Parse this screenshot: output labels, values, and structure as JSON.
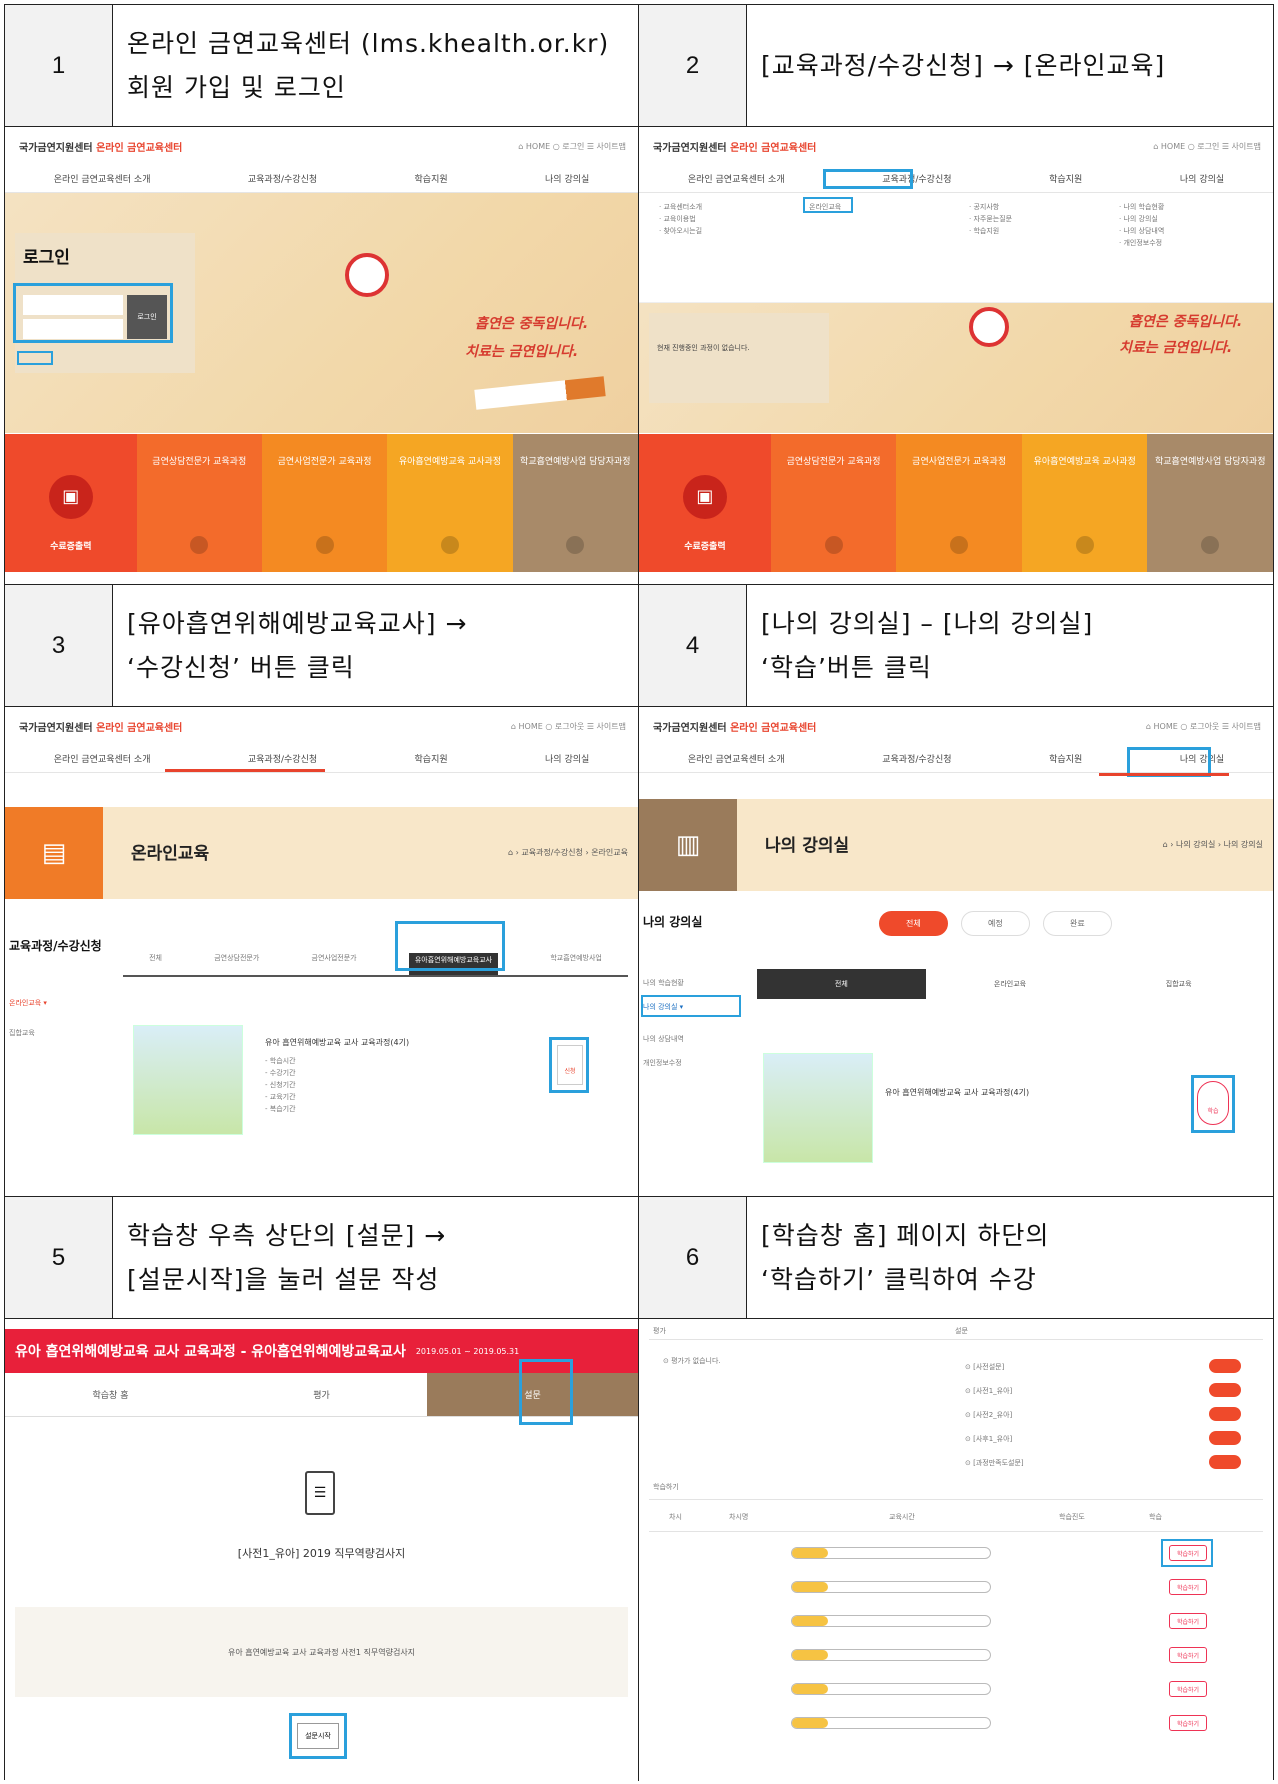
{
  "steps": [
    {
      "num": "1",
      "line1": "온라인 금연교육센터 (lms.khealth.or.kr)",
      "line2": "회원 가입 및 로그인"
    },
    {
      "num": "2",
      "line1": "[교육과정/수강신청] → [온라인교육]",
      "line2": ""
    },
    {
      "num": "3",
      "line1": "[유아흡연위해예방교육교사] →",
      "line2": "‘수강신청’ 버튼 클릭"
    },
    {
      "num": "4",
      "line1": "[나의 강의실] – [나의 강의실]",
      "line2": "‘학습’버튼 클릭"
    },
    {
      "num": "5",
      "line1": "학습창 우측 상단의 [설문] →",
      "line2": "[설문시작]을 눌러 설문 작성"
    },
    {
      "num": "6",
      "line1": "[학습창 홈] 페이지 하단의",
      "line2": "‘학습하기’ 클릭하여 수강"
    }
  ],
  "site": {
    "logo_prefix": "국가금연지원센터",
    "logo_name": "온라인 금연교육센터",
    "nav": [
      "온라인 금연교육센터 소개",
      "교육과정/수강신청",
      "학습지원",
      "나의 강의실"
    ],
    "login_title": "로그인",
    "login_button": "로그인",
    "slogan1": "흡연은 중독입니다.",
    "slogan2": "치료는 금연입니다.",
    "notice": "현재 진행중인 과정이 없습니다.",
    "cert_tile": "수료증출력",
    "tiles": [
      "금연상담전문가 교육과정",
      "금연사업전문가 교육과정",
      "유아흡연예방교육 교사과정",
      "학교흡연예방사업 담당자과정"
    ],
    "online_edu": "온라인교육",
    "my_room": "나의 강의실",
    "side_menu_title": "교육과정/수강신청",
    "course_name": "유아 흡연위해예방교육 교사 교육과정(4기)",
    "survey_header": "유아 흡연위해예방교육 교사 교육과정 - 유아흡연위해예방교육교사",
    "survey_dates": "2019.05.01 ~ 2019.05.31",
    "survey_tabs": [
      "학습창 홈",
      "평가",
      "설문"
    ],
    "survey_title": "[사전1_유아] 2019 직무역량검사지",
    "survey_sub": "유아 흡연예방교육 교사 교육과정 사전1 직무역량검사지",
    "survey_start": "설문시작"
  }
}
